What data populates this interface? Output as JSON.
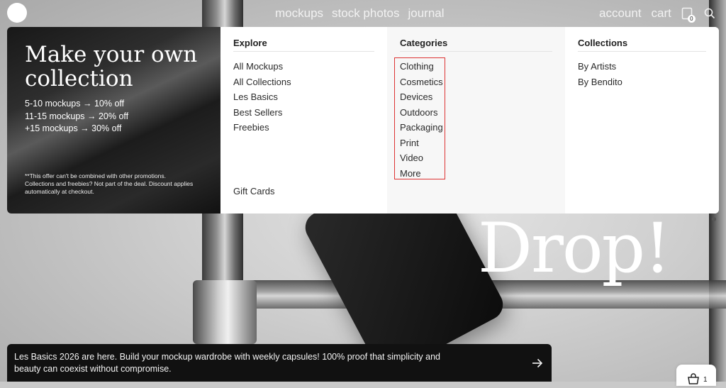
{
  "nav": {
    "center": [
      "mockups",
      "stock photos",
      "journal"
    ],
    "account": "account",
    "cart": "cart",
    "cart_count": "0",
    "cart_icon": "cart-icon",
    "search_icon": "search-icon"
  },
  "promo": {
    "title": "Make your own collection",
    "lines": [
      "5-10 mockups → 10% off",
      "11-15 mockups → 20% off",
      "+15 mockups → 30% off"
    ],
    "note": "**This offer can't be combined with other promotions. Collections and freebies? Not part of the deal. Discount applies automatically at checkout."
  },
  "explore": {
    "heading": "Explore",
    "items": [
      "All Mockups",
      "All Collections",
      "Les Basics",
      "Best Sellers",
      "Freebies"
    ],
    "gift": "Gift Cards"
  },
  "categories": {
    "heading": "Categories",
    "items": [
      "Clothing",
      "Cosmetics",
      "Devices",
      "Outdoors",
      "Packaging",
      "Print",
      "Video",
      "More"
    ]
  },
  "collections": {
    "heading": "Collections",
    "items": [
      "By Artists",
      "By Bendito"
    ]
  },
  "hero": {
    "headline": "Drop!"
  },
  "announcement": {
    "text": "Les Basics 2026 are here. Build your mockup wardrobe with weekly capsules! 100% proof that simplicity and beauty can coexist without compromise.",
    "arrow_icon": "arrow-right-icon"
  },
  "bag": {
    "count": "1",
    "icon": "bag-icon"
  },
  "colors": {
    "highlight": "#d33333",
    "announcement_bg": "#111111"
  }
}
